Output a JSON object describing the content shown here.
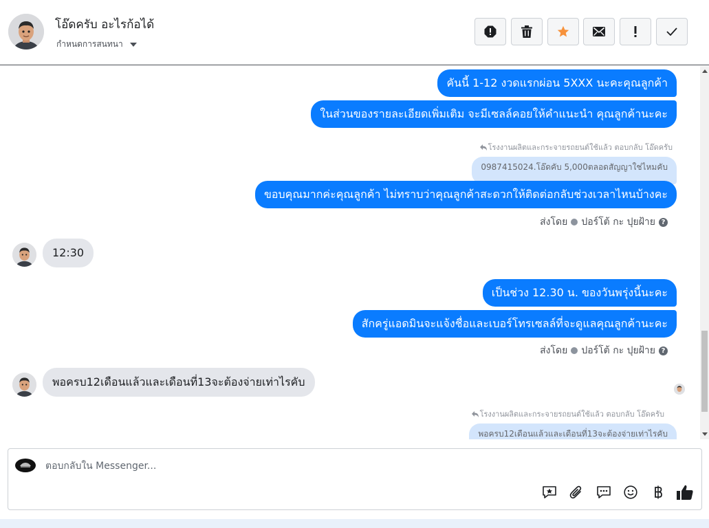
{
  "header": {
    "contact_name": "โอ๊ดครับ อะไรก้อได้",
    "label_dropdown": "กำหนดการสนทนา",
    "toolbar": {
      "spam": "spam-icon",
      "delete": "trash-icon",
      "star": "star-icon",
      "unread": "envelope-icon",
      "important": "exclamation-icon",
      "done": "checkmark-icon"
    }
  },
  "thread": {
    "messages": [
      {
        "direction": "out",
        "text": "คันนี้ 1-12 งวดแรกผ่อน 5XXX นะคะคุณลูกค้า"
      },
      {
        "direction": "out",
        "text": "ในส่วนของรายละเอียดเพิ่มเติม จะมีเซลล์คอยให้คำแนะนำ คุณลูกค้านะคะ"
      },
      {
        "direction": "reply_note",
        "text": "โรงงานผลิตและกระจายรถยนต์ใช้แล้ว ตอบกลับ โอ๊ดครับ"
      },
      {
        "direction": "reply_quote",
        "text": "0987415024.โอ๊ดคับ 5,000ตลอดสัญญาใช่ไหมคับ"
      },
      {
        "direction": "out",
        "text": "ขอบคุณมากค่ะคุณลูกค้า ไม่ทราบว่าคุณลูกค้าสะดวกให้ติดต่อกลับช่วงเวลาไหนบ้างคะ"
      },
      {
        "direction": "sent_by",
        "prefix": "ส่งโดย",
        "name": "ปอร์โต้ กะ ปุยฝ้าย"
      },
      {
        "direction": "in",
        "text": "12:30"
      },
      {
        "direction": "out",
        "text": "เป็นช่วง 12.30 น. ของวันพรุ่งนี้นะคะ"
      },
      {
        "direction": "out",
        "text": "สักครู่แอดมินจะแจ้งชื่อและเบอร์โทรเซลล์ที่จะดูแลคุณลูกค้านะคะ"
      },
      {
        "direction": "sent_by",
        "prefix": "ส่งโดย",
        "name": "ปอร์โต้ กะ ปุยฝ้าย"
      },
      {
        "direction": "in",
        "text": "พอครบ12เดือนแล้วและเดือนที่13จะต้องจ่ายเท่าไรคับ"
      },
      {
        "direction": "reply_note",
        "text": "โรงงานผลิตและกระจายรถยนต์ใช้แล้ว ตอบกลับ โอ๊ดครับ"
      },
      {
        "direction": "reply_quote",
        "text": "พอครบ12เดือนแล้วและเดือนที่13จะต้องจ่ายเท่าไรคับ"
      }
    ]
  },
  "composer": {
    "placeholder": "ตอบกลับใน Messenger...",
    "value": "",
    "icons": [
      "sticker-icon",
      "attachment-icon",
      "saved-replies-icon",
      "emoji-icon",
      "payment-icon",
      "like-icon"
    ]
  },
  "colors": {
    "outgoing_bubble": "#0a7cff",
    "incoming_bubble": "#e4e6eb",
    "quote_bubble": "#d3e5fc",
    "star": "#f7923b"
  }
}
